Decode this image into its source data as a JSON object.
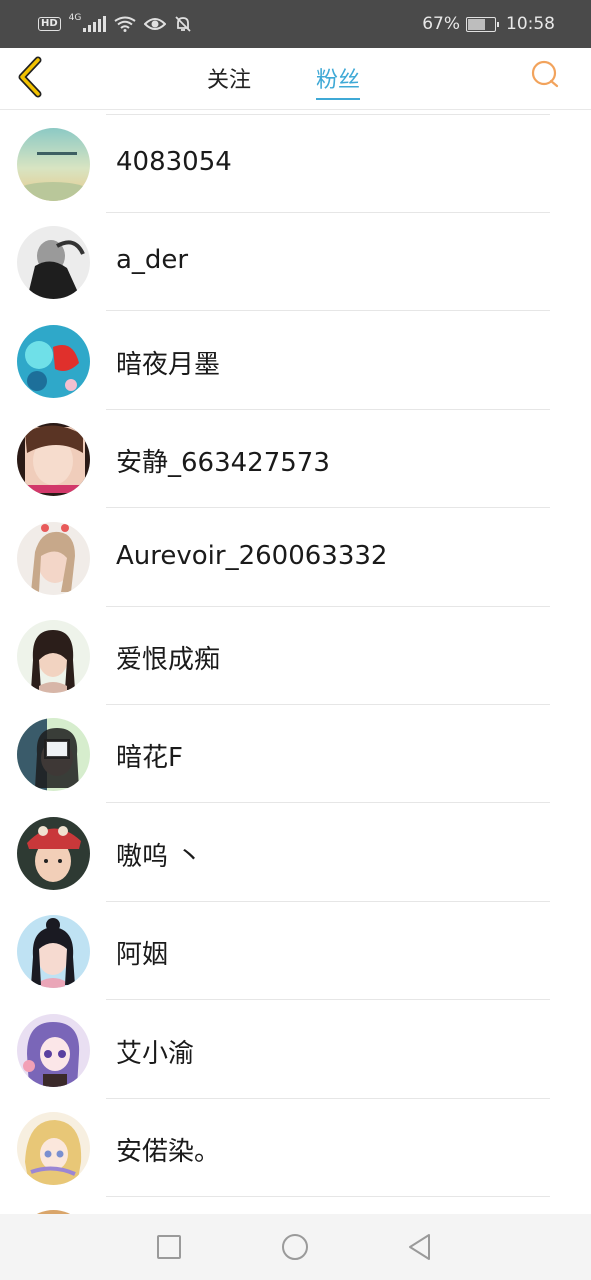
{
  "status_bar": {
    "hd": "HD",
    "network": "4G",
    "battery_percent_label": "67%",
    "battery_level": 0.67,
    "time": "10:58",
    "icons": [
      "signal-icon",
      "wifi-icon",
      "eye-icon",
      "bell-off-icon",
      "battery-icon"
    ]
  },
  "header": {
    "back_icon": "chevron-left-icon",
    "tabs": [
      {
        "label": "关注",
        "active": false
      },
      {
        "label": "粉丝",
        "active": true
      }
    ],
    "search_icon": "search-icon",
    "colors": {
      "accent": "#3fa9d6",
      "back": "#f2c200",
      "search": "#f2a35c"
    }
  },
  "fans": [
    {
      "name": "4083054"
    },
    {
      "name": "a_der"
    },
    {
      "name": "暗夜月墨"
    },
    {
      "name": "安静_663427573"
    },
    {
      "name": "Aurevoir_260063332"
    },
    {
      "name": "爱恨成痴"
    },
    {
      "name": "暗花F"
    },
    {
      "name": "嗷呜 丶"
    },
    {
      "name": "阿姻"
    },
    {
      "name": "艾小渝"
    },
    {
      "name": "安偌染。"
    }
  ],
  "bottom_nav": {
    "icons": [
      "square-icon",
      "circle-icon",
      "triangle-back-icon"
    ]
  }
}
